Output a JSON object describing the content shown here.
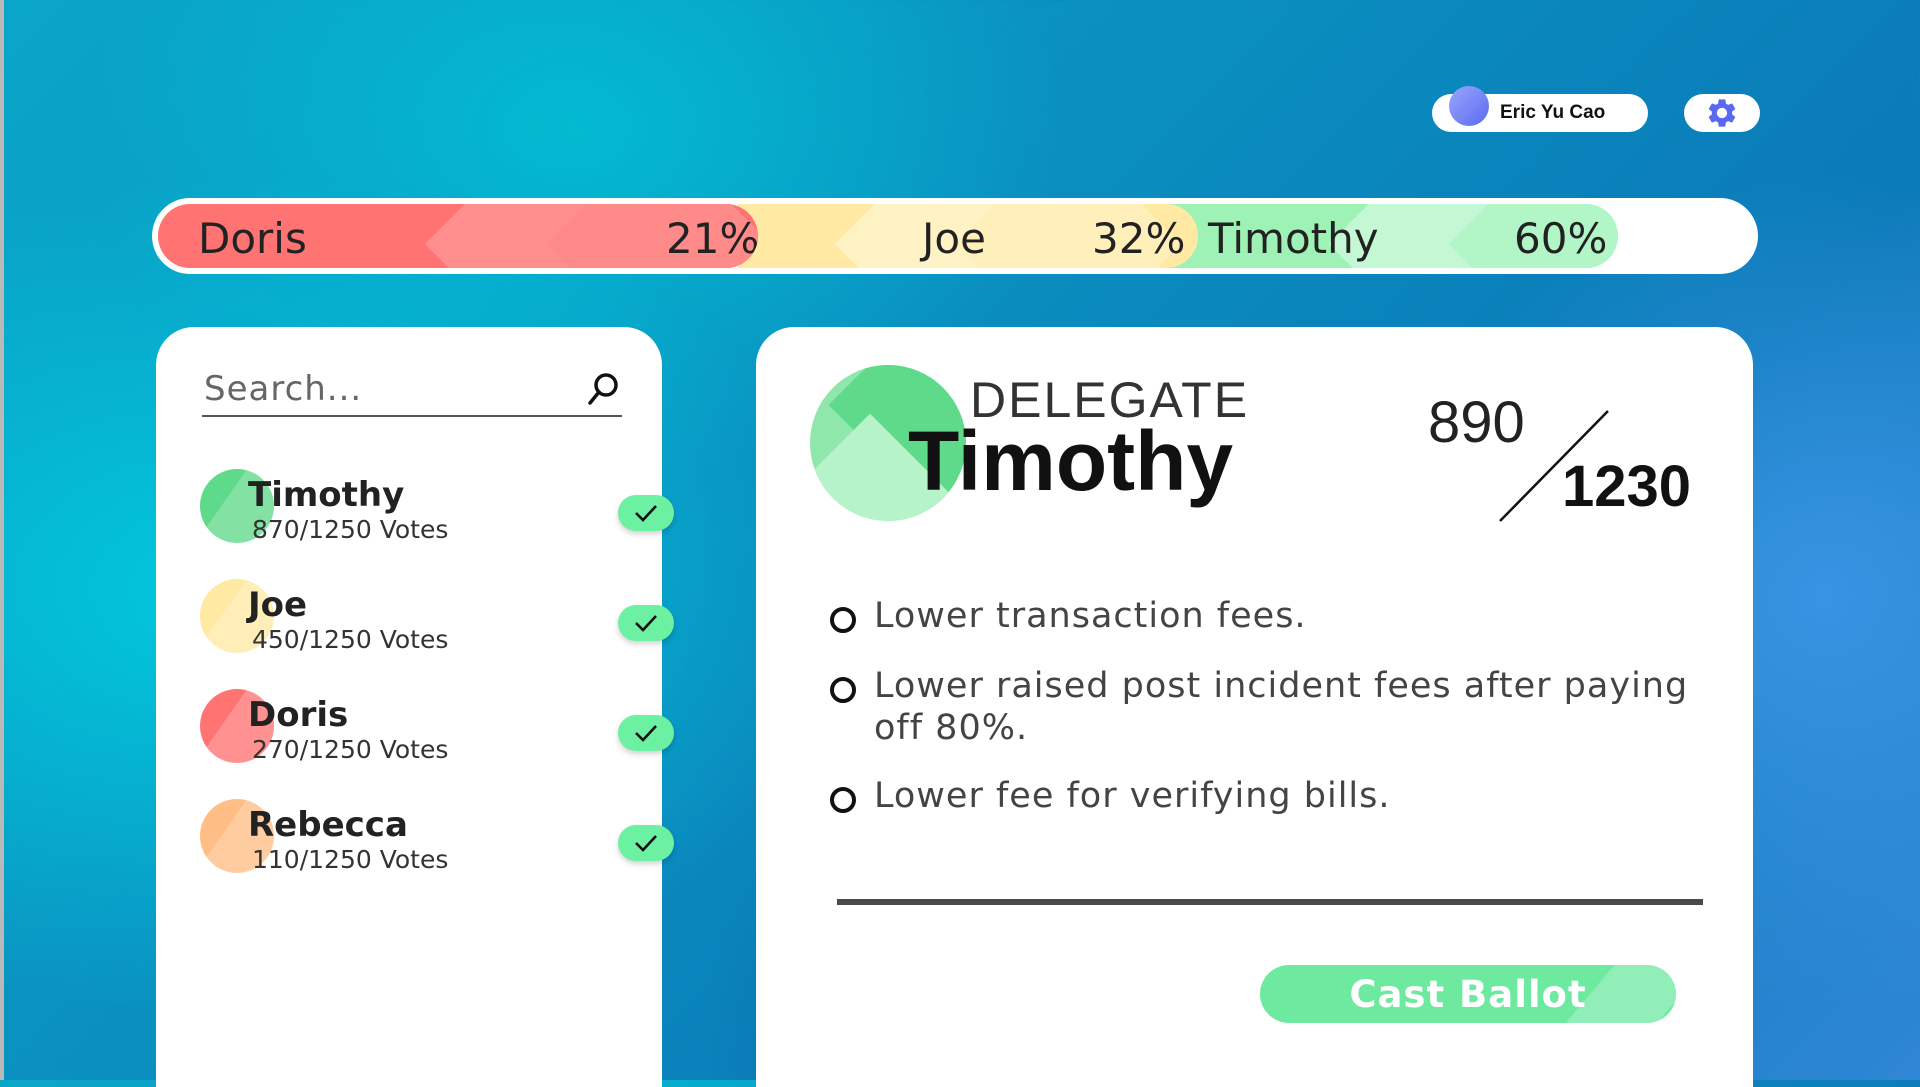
{
  "header": {
    "user_name": "Eric Yu Cao",
    "settings_icon": "gear-icon"
  },
  "results_bar": {
    "segments": [
      {
        "name": "Doris",
        "percent": "21%",
        "color": "#ff7373"
      },
      {
        "name": "Joe",
        "percent": "32%",
        "color": "#ffe9a3"
      },
      {
        "name": "Timothy",
        "percent": "60%",
        "color": "#9ff2b6"
      }
    ]
  },
  "sidebar": {
    "search_placeholder": "Search...",
    "candidates": [
      {
        "name": "Timothy",
        "votes": "870/1250 Votes",
        "color": "#5fd98a",
        "checked": true
      },
      {
        "name": "Joe",
        "votes": "450/1250 Votes",
        "color": "#ffe9a3",
        "checked": true
      },
      {
        "name": "Doris",
        "votes": "270/1250 Votes",
        "color": "#ff7373",
        "checked": true
      },
      {
        "name": "Rebecca",
        "votes": "110/1250 Votes",
        "color": "#ffbe86",
        "checked": true
      }
    ]
  },
  "detail": {
    "label": "DELEGATE",
    "name": "Timothy",
    "votes_current": "890",
    "votes_required": "1230",
    "policies": [
      "Lower transaction fees.",
      "Lower raised post incident fees after paying off 80%.",
      "Lower fee for verifying bills."
    ],
    "cast_button": "Cast Ballot"
  },
  "colors": {
    "accent_green": "#6ee9a0"
  }
}
